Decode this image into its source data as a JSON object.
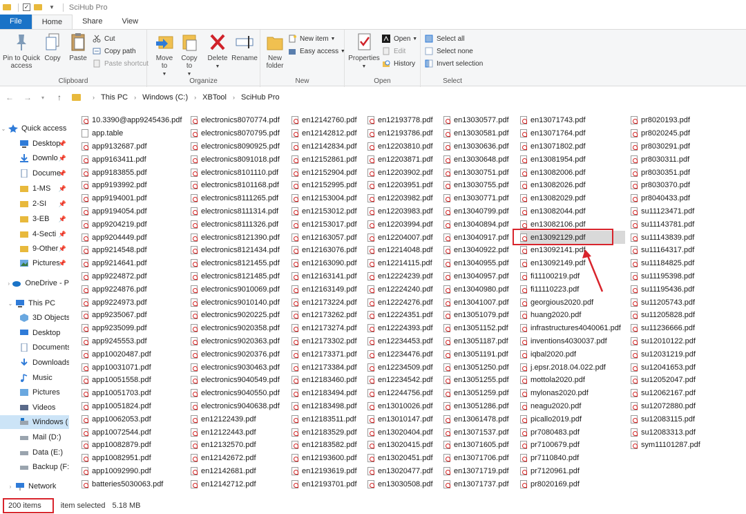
{
  "window": {
    "title": "SciHub Pro"
  },
  "ribbon_tabs": [
    "File",
    "Home",
    "Share",
    "View"
  ],
  "ribbon": {
    "clipboard": {
      "pin": "Pin to Quick access",
      "copy": "Copy",
      "paste": "Paste",
      "cut": "Cut",
      "copy_path": "Copy path",
      "paste_shortcut": "Paste shortcut",
      "label": "Clipboard"
    },
    "organize": {
      "move_to": "Move to",
      "copy_to": "Copy to",
      "delete": "Delete",
      "rename": "Rename",
      "label": "Organize"
    },
    "new": {
      "new_folder": "New folder",
      "new_item": "New item",
      "easy_access": "Easy access",
      "label": "New"
    },
    "open": {
      "properties": "Properties",
      "open": "Open",
      "edit": "Edit",
      "history": "History",
      "label": "Open"
    },
    "select": {
      "select_all": "Select all",
      "select_none": "Select none",
      "invert": "Invert selection",
      "label": "Select"
    }
  },
  "breadcrumb": [
    "This PC",
    "Windows (C:)",
    "XBTool",
    "SciHub Pro"
  ],
  "nav": {
    "quick_access": "Quick access",
    "pinned": [
      "Desktop",
      "Downlo",
      "Docume",
      "1-MS",
      "2-SI",
      "3-EB",
      "4-Secti",
      "9-Other",
      "Pictures"
    ],
    "onedrive": "OneDrive - P",
    "this_pc": "This PC",
    "pc_items": [
      "3D Objects",
      "Desktop",
      "Documents",
      "Downloads",
      "Music",
      "Pictures",
      "Videos",
      "Windows (",
      "Mail (D:)",
      "Data (E:)",
      "Backup (F:)"
    ],
    "network": "Network"
  },
  "columns": [
    [
      "10.3390@app9245436.pdf",
      "app.table",
      "app9132687.pdf",
      "app9163411.pdf",
      "app9183855.pdf",
      "app9193992.pdf",
      "app9194001.pdf",
      "app9194054.pdf",
      "app9204219.pdf",
      "app9204449.pdf",
      "app9214548.pdf",
      "app9214641.pdf",
      "app9224872.pdf",
      "app9224876.pdf",
      "app9224973.pdf",
      "app9235067.pdf",
      "app9235099.pdf",
      "app9245553.pdf",
      "app10020487.pdf",
      "app10031071.pdf",
      "app10051558.pdf",
      "app10051703.pdf",
      "app10051824.pdf",
      "app10062053.pdf",
      "app10072544.pdf",
      "app10082879.pdf",
      "app10082951.pdf",
      "app10092990.pdf",
      "batteries5030063.pdf"
    ],
    [
      "electronics8070774.pdf",
      "electronics8070795.pdf",
      "electronics8090925.pdf",
      "electronics8091018.pdf",
      "electronics8101110.pdf",
      "electronics8101168.pdf",
      "electronics8111265.pdf",
      "electronics8111314.pdf",
      "electronics8111326.pdf",
      "electronics8121390.pdf",
      "electronics8121434.pdf",
      "electronics8121455.pdf",
      "electronics8121485.pdf",
      "electronics9010069.pdf",
      "electronics9010140.pdf",
      "electronics9020225.pdf",
      "electronics9020358.pdf",
      "electronics9020363.pdf",
      "electronics9020376.pdf",
      "electronics9030463.pdf",
      "electronics9040549.pdf",
      "electronics9040550.pdf",
      "electronics9040638.pdf",
      "en12122439.pdf",
      "en12122443.pdf",
      "en12132570.pdf",
      "en12142672.pdf",
      "en12142681.pdf",
      "en12142712.pdf"
    ],
    [
      "en12142760.pdf",
      "en12142812.pdf",
      "en12142834.pdf",
      "en12152861.pdf",
      "en12152904.pdf",
      "en12152995.pdf",
      "en12153004.pdf",
      "en12153012.pdf",
      "en12153017.pdf",
      "en12163057.pdf",
      "en12163076.pdf",
      "en12163090.pdf",
      "en12163141.pdf",
      "en12163149.pdf",
      "en12173224.pdf",
      "en12173262.pdf",
      "en12173274.pdf",
      "en12173302.pdf",
      "en12173371.pdf",
      "en12173384.pdf",
      "en12183460.pdf",
      "en12183494.pdf",
      "en12183498.pdf",
      "en12183511.pdf",
      "en12183529.pdf",
      "en12183582.pdf",
      "en12193600.pdf",
      "en12193619.pdf",
      "en12193701.pdf"
    ],
    [
      "en12193778.pdf",
      "en12193786.pdf",
      "en12203810.pdf",
      "en12203871.pdf",
      "en12203902.pdf",
      "en12203951.pdf",
      "en12203982.pdf",
      "en12203983.pdf",
      "en12203994.pdf",
      "en12204007.pdf",
      "en12214048.pdf",
      "en12214115.pdf",
      "en12224239.pdf",
      "en12224240.pdf",
      "en12224276.pdf",
      "en12224351.pdf",
      "en12224393.pdf",
      "en12234453.pdf",
      "en12234476.pdf",
      "en12234509.pdf",
      "en12234542.pdf",
      "en12244756.pdf",
      "en13010026.pdf",
      "en13010147.pdf",
      "en13020404.pdf",
      "en13020415.pdf",
      "en13020451.pdf",
      "en13020477.pdf",
      "en13030508.pdf"
    ],
    [
      "en13030577.pdf",
      "en13030581.pdf",
      "en13030636.pdf",
      "en13030648.pdf",
      "en13030751.pdf",
      "en13030755.pdf",
      "en13030771.pdf",
      "en13040799.pdf",
      "en13040894.pdf",
      "en13040917.pdf",
      "en13040922.pdf",
      "en13040955.pdf",
      "en13040957.pdf",
      "en13040980.pdf",
      "en13041007.pdf",
      "en13051079.pdf",
      "en13051152.pdf",
      "en13051187.pdf",
      "en13051191.pdf",
      "en13051250.pdf",
      "en13051255.pdf",
      "en13051259.pdf",
      "en13051286.pdf",
      "en13061478.pdf",
      "en13071537.pdf",
      "en13071605.pdf",
      "en13071706.pdf",
      "en13071719.pdf",
      "en13071737.pdf"
    ],
    [
      "en13071743.pdf",
      "en13071764.pdf",
      "en13071802.pdf",
      "en13081954.pdf",
      "en13082006.pdf",
      "en13082026.pdf",
      "en13082029.pdf",
      "en13082044.pdf",
      "en13082106.pdf",
      "en13092129.pdf",
      "en13092141.pdf",
      "en13092149.pdf",
      "fi11100219.pdf",
      "fi11110223.pdf",
      "georgious2020.pdf",
      "huang2020.pdf",
      "infrastructures4040061.pdf",
      "inventions4030037.pdf",
      "iqbal2020.pdf",
      "j.epsr.2018.04.022.pdf",
      "mottola2020.pdf",
      "mylonas2020.pdf",
      "neagu2020.pdf",
      "picallo2019.pdf",
      "pr7080483.pdf",
      "pr7100679.pdf",
      "pr7110840.pdf",
      "pr7120961.pdf",
      "pr8020169.pdf"
    ],
    [
      "pr8020193.pdf",
      "pr8020245.pdf",
      "pr8030291.pdf",
      "pr8030311.pdf",
      "pr8030351.pdf",
      "pr8030370.pdf",
      "pr8040433.pdf",
      "su11123471.pdf",
      "su11143781.pdf",
      "su11143839.pdf",
      "su11164317.pdf",
      "su11184825.pdf",
      "su11195398.pdf",
      "su11195436.pdf",
      "su11205743.pdf",
      "su11205828.pdf",
      "su11236666.pdf",
      "su12010122.pdf",
      "su12031219.pdf",
      "su12041653.pdf",
      "su12052047.pdf",
      "su12062167.pdf",
      "su12072880.pdf",
      "su12083115.pdf",
      "su12083313.pdf",
      "sym11101287.pdf"
    ]
  ],
  "selected_file": "en13092129.pdf",
  "status": {
    "count": "200 items",
    "selection": "item selected",
    "size": "5.18 MB"
  },
  "colors": {
    "accent": "#1a73c7",
    "highlight_box": "#d8242c",
    "folder": "#e8b93c"
  }
}
